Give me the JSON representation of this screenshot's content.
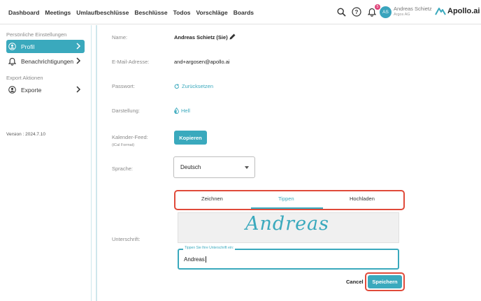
{
  "nav": {
    "items": [
      "Dashboard",
      "Meetings",
      "Umlaufbeschlüsse",
      "Beschlüsse",
      "Todos",
      "Vorschläge",
      "Boards"
    ]
  },
  "header": {
    "notification_count": "5",
    "avatar_initials": "AS",
    "user_name": "Andreas Schietz",
    "user_org": "Argos AG",
    "logo_text": "Apollo.ai"
  },
  "sidebar": {
    "section1": "Persönliche Einstellungen",
    "items1": [
      {
        "label": "Profil",
        "icon": "user-circle-icon"
      },
      {
        "label": "Benachrichtigungen",
        "icon": "bell-icon"
      }
    ],
    "section2": "Export Aktionen",
    "items2": [
      {
        "label": "Exporte",
        "icon": "user-circle-icon"
      }
    ],
    "version": "Version : 2024.7.10"
  },
  "profile": {
    "name_label": "Name:",
    "name_value": "Andreas Schietz (Sie)",
    "email_label": "E-Mail-Adresse:",
    "email_value": "and+argosen@apollo.ai",
    "password_label": "Passwort:",
    "password_link": "Zurücksetzen",
    "theme_label": "Darstellung:",
    "theme_value": "Hell",
    "calendar_label": "Kalender-Feed:",
    "calendar_sub": "(iCal Format)",
    "calendar_button": "Kopieren",
    "language_label": "Sprache:",
    "language_value": "Deutsch",
    "signature_label": "Unterschrift:"
  },
  "signature": {
    "tabs": [
      "Zeichnen",
      "Tippen",
      "Hochladen"
    ],
    "active_tab": "Tippen",
    "preview_text": "Andreas",
    "input_label": "Tippen Sie Ihre Unterschrift ein:",
    "input_value": "Andreas",
    "cancel_label": "Cancel",
    "save_label": "Speichern"
  },
  "colors": {
    "accent": "#3aa9bd",
    "highlight": "#e04a3a",
    "badge": "#e0457b"
  }
}
